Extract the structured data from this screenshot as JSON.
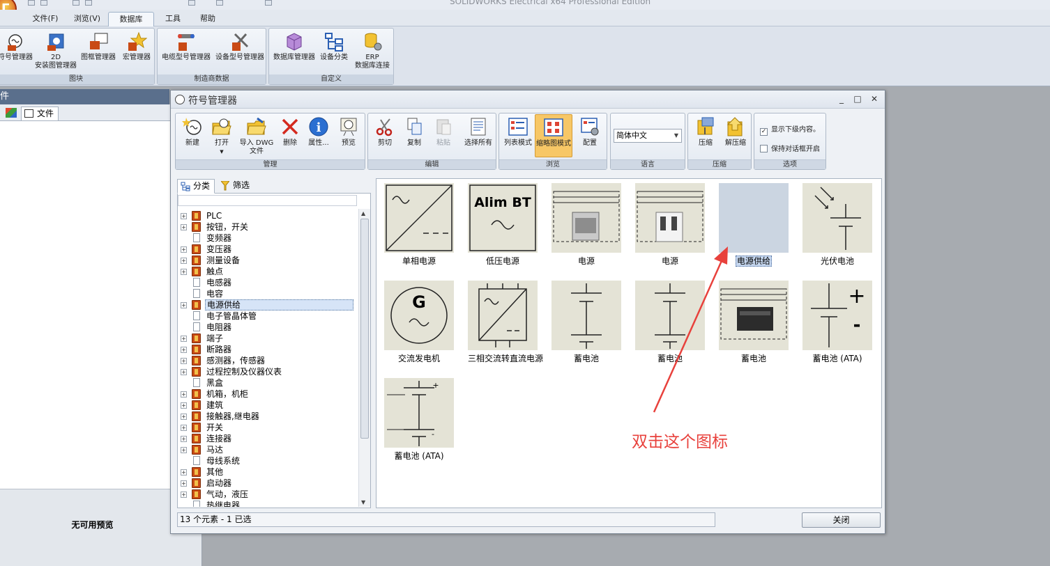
{
  "app": {
    "title": "SOLIDWORKS Electrical x64 Professional Edition",
    "logo_text": "Γ"
  },
  "menu": {
    "tabs": [
      {
        "label": "文件(F)"
      },
      {
        "label": "浏览(V)"
      },
      {
        "label": "数据库(B)"
      },
      {
        "label": "工具"
      },
      {
        "label": "帮助"
      }
    ]
  },
  "ribbon": {
    "groups": [
      {
        "label": "图块",
        "buttons": [
          "符号管理器",
          "2D",
          "安装图管理器",
          "图框管理器",
          "宏管理器"
        ]
      },
      {
        "label": "制造商数据",
        "buttons": [
          "电缆型号管理器",
          "设备型号管理器"
        ]
      },
      {
        "label": "自定义",
        "buttons": [
          "数据库管理器",
          "设备分类",
          "ERP",
          "数据库连接"
        ]
      }
    ]
  },
  "left_panel": {
    "header": "件",
    "file_tab": "文件",
    "no_preview": "无可用预览"
  },
  "dialog": {
    "title": "符号管理器",
    "window_buttons": [
      "_",
      "□",
      "✕"
    ],
    "groups": {
      "manage": {
        "label": "管理",
        "buttons": [
          "新建",
          "打开",
          "导入 DWG",
          "文件",
          "删除",
          "属性...",
          "预览"
        ]
      },
      "edit": {
        "label": "编辑",
        "buttons": [
          "剪切",
          "复制",
          "粘贴",
          "选择所有"
        ]
      },
      "browse": {
        "label": "浏览",
        "buttons": [
          "列表模式",
          "缩略图模式",
          "配置"
        ]
      },
      "language": {
        "label": "语言",
        "selected": "简体中文"
      },
      "compress": {
        "label": "压缩",
        "buttons": [
          "压缩",
          "解压缩"
        ]
      },
      "options": {
        "label": "选项",
        "show_sublevel": "显示下级内容。",
        "show_sublevel_checked": true,
        "keep_open": "保持对话框开启",
        "keep_open_checked": false
      }
    },
    "tree_tabs": [
      "分类",
      "筛选"
    ],
    "tree_items": [
      {
        "label": "PLC",
        "expandable": true
      },
      {
        "label": "按钮，开关",
        "expandable": true
      },
      {
        "label": "变频器",
        "expandable": false
      },
      {
        "label": "变压器",
        "expandable": true
      },
      {
        "label": "测量设备",
        "expandable": true
      },
      {
        "label": "触点",
        "expandable": true
      },
      {
        "label": "电感器",
        "expandable": false
      },
      {
        "label": "电容",
        "expandable": false
      },
      {
        "label": "电源供给",
        "expandable": true,
        "selected": true
      },
      {
        "label": "电子管晶体管",
        "expandable": false
      },
      {
        "label": "电阻器",
        "expandable": false
      },
      {
        "label": "端子",
        "expandable": true
      },
      {
        "label": "断路器",
        "expandable": true
      },
      {
        "label": "感测器，传感器",
        "expandable": true
      },
      {
        "label": "过程控制及仪器仪表",
        "expandable": true
      },
      {
        "label": "黑盒",
        "expandable": false
      },
      {
        "label": "机箱，机柜",
        "expandable": true
      },
      {
        "label": "建筑",
        "expandable": true
      },
      {
        "label": "接触器,继电器",
        "expandable": true
      },
      {
        "label": "开关",
        "expandable": true
      },
      {
        "label": "连接器",
        "expandable": true
      },
      {
        "label": "马达",
        "expandable": true
      },
      {
        "label": "母线系统",
        "expandable": false
      },
      {
        "label": "其他",
        "expandable": true
      },
      {
        "label": "启动器",
        "expandable": true
      },
      {
        "label": "气动，液压",
        "expandable": true
      },
      {
        "label": "热继电器",
        "expandable": false
      }
    ],
    "thumbnails": [
      {
        "label": "单相电源",
        "kind": "ac-dc"
      },
      {
        "label": "低压电源",
        "kind": "alim",
        "text": "Alim BT"
      },
      {
        "label": "电源",
        "kind": "device"
      },
      {
        "label": "电源",
        "kind": "device2"
      },
      {
        "label": "电源供给",
        "kind": "empty",
        "selected": true
      },
      {
        "label": "光伏电池",
        "kind": "pv"
      },
      {
        "label": "交流发电机",
        "kind": "gen",
        "text": "G"
      },
      {
        "label": "三相交流转直流电源",
        "kind": "ac-dc3"
      },
      {
        "label": "蓄电池",
        "kind": "battery"
      },
      {
        "label": "蓄电池",
        "kind": "battery"
      },
      {
        "label": "蓄电池",
        "kind": "battery-dev"
      },
      {
        "label": "蓄电池 (ATA)",
        "kind": "battery-ata",
        "plus": "+",
        "minus": "-"
      },
      {
        "label": "蓄电池 (ATA)",
        "kind": "battery-ata2",
        "plus": "+",
        "minus": "-"
      }
    ],
    "status": "13 个元素 - 1 已选",
    "close_label": "关闭"
  },
  "annotation": {
    "text": "双击这个图标",
    "color": "#e8413c"
  }
}
